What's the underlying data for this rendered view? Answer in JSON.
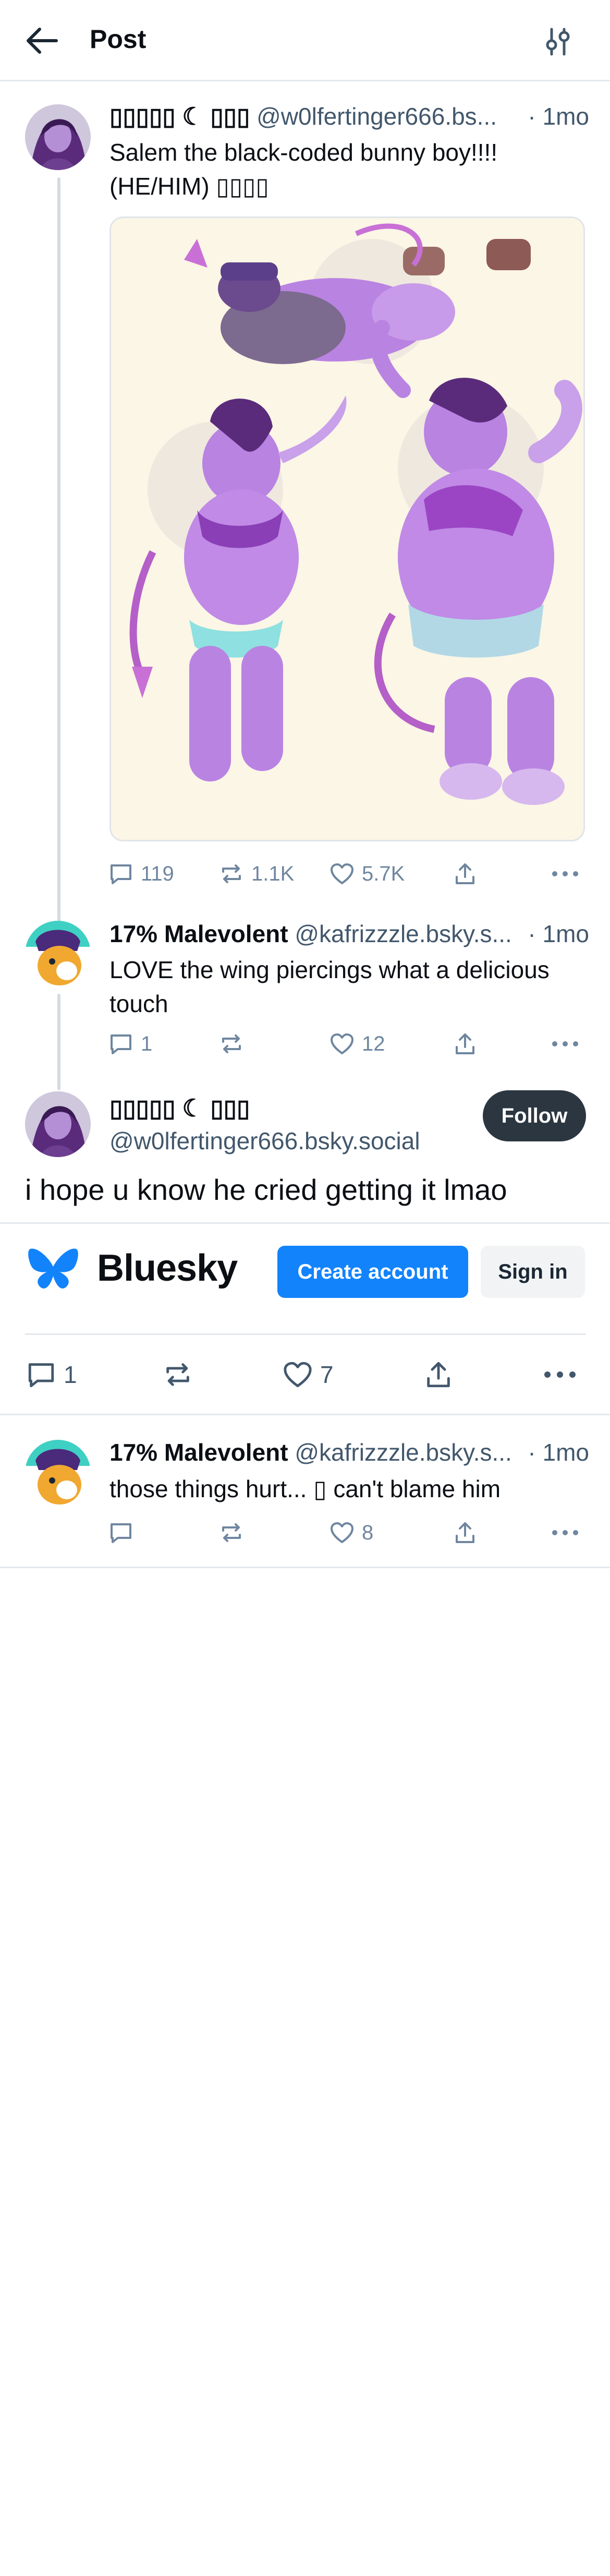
{
  "header": {
    "title": "Post"
  },
  "root_post": {
    "author_name": "▯▯▯▯▯ ☾ ▯▯▯",
    "handle": "@w0lfertinger666.bs...",
    "time": "· 1mo",
    "text_line1": "Salem the black-coded bunny boy!!!!",
    "text_line2": "(HE/HIM) ▯▯▯▯",
    "image_icon": "character-art-image",
    "replies": "119",
    "reposts": "1.1K",
    "likes": "5.7K"
  },
  "reply1": {
    "author_name": "17% Malevolent",
    "handle": "@kafrizzzle.bsky.s...",
    "time": "· 1mo",
    "text_line1": "LOVE the wing piercings what a delicious",
    "text_line2": "touch",
    "replies": "1",
    "likes": "12"
  },
  "focus_post": {
    "author_name": "▯▯▯▯▯ ☾ ▯▯▯",
    "handle": "@w0lfertinger666.bsky.social",
    "follow_label": "Follow",
    "text": "i hope u know he cried getting it lmao",
    "replies": "1",
    "likes": "7"
  },
  "signup_banner": {
    "brand": "Bluesky",
    "create_label": "Create account",
    "signin_label": "Sign in",
    "accent": "#1283fb"
  },
  "reply2": {
    "author_name": "17% Malevolent",
    "handle": "@kafrizzzle.bsky.s...",
    "time": "· 1mo",
    "text": "those things hurt... ▯ can't blame him",
    "likes": "8"
  },
  "colors": {
    "muted": "#6f869f",
    "handle": "#42576c",
    "follow_bg": "#2b3640"
  }
}
